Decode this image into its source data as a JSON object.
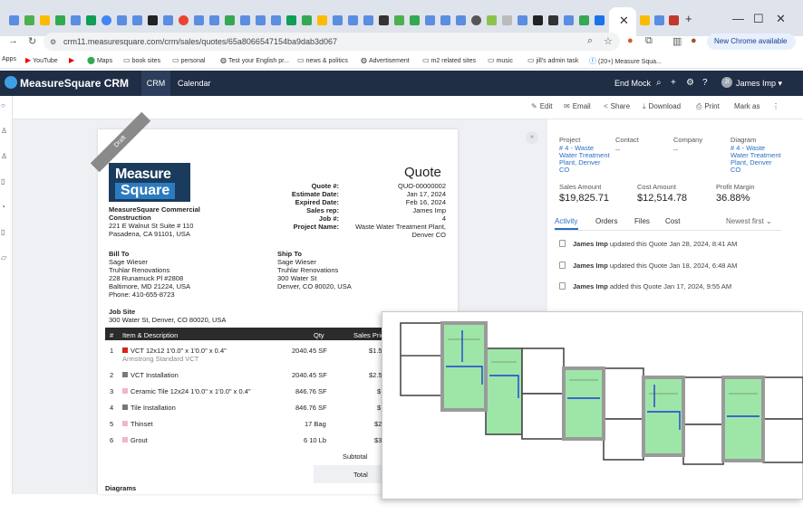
{
  "browser": {
    "url": "crm11.measuresquare.com/crm/sales/quotes/65a8066547154ba9dab3d067",
    "update_label": "New Chrome available",
    "close_tab": "✕"
  },
  "bookmarks": [
    "Apps",
    "YouTube",
    "Maps",
    "book sites",
    "personal",
    "Test your English pr...",
    "news & politics",
    "Advertisement",
    "m2 related sites",
    "music",
    "jill's admin task",
    "(20+) Measure Squa..."
  ],
  "app": {
    "brand": "MeasureSquare CRM",
    "nav": [
      "CRM",
      "Calendar"
    ],
    "end_mock": "End Mock",
    "user_initials": "JI",
    "user_name": "James Imp"
  },
  "toolbar": [
    "Edit",
    "Email",
    "Share",
    "Download",
    "Print",
    "Mark as"
  ],
  "quote_doc": {
    "status": "Draft",
    "logo_line1": "Measure",
    "logo_line2": "Square",
    "company": [
      "MeasureSquare Commercial",
      "Construction",
      "221 E Walnut St Suite # 110",
      "Pasadena, CA 91101, USA"
    ],
    "title": "Quote",
    "fields": [
      {
        "label": "Quote #:",
        "value": "QUO-00000002"
      },
      {
        "label": "Estimate Date:",
        "value": "Jan 17, 2024"
      },
      {
        "label": "Expired Date:",
        "value": "Feb 16, 2024"
      },
      {
        "label": "Sales rep:",
        "value": "James Imp"
      },
      {
        "label": "Job #:",
        "value": "4"
      },
      {
        "label": "Project Name:",
        "value": "Waste Water Treatment Plant,"
      }
    ],
    "project_name_line2": "Denver CO",
    "bill_to": {
      "label": "Bill To",
      "lines": [
        "Sage Wieser",
        "Truhlar Renovations",
        "228 Runamuck Pl #2808",
        "Baltimore, MD 21224, USA",
        "Phone: 410-655-8723"
      ]
    },
    "ship_to": {
      "label": "Ship To",
      "lines": [
        "Sage Wieser",
        "Truhlar Renovations",
        "300 Water St",
        "Denver, CO 80020, USA"
      ]
    },
    "job_site": {
      "label": "Job Site",
      "address": "300 Water St, Denver, CO 80020, USA"
    },
    "columns": [
      "#",
      "Item & Description",
      "Qty",
      "Sales Price"
    ],
    "items": [
      {
        "n": "1",
        "desc": "VCT 12x12 1'0.0\" x 1'0.0\" x 0.4\"",
        "sub": "Armstrong Standard VCT",
        "qty": "2040.45 SF",
        "price": "$1.5",
        "color": "#d9241e"
      },
      {
        "n": "2",
        "desc": "VCT Installation",
        "sub": "",
        "qty": "2040.45 SF",
        "price": "$2.5",
        "color": "#7b7b7b"
      },
      {
        "n": "3",
        "desc": "Ceramic Tile 12x24 1'0.0\" x 1'0.0\" x 0.4\"",
        "sub": "",
        "qty": "846.76 SF",
        "price": "$",
        "color": "#f1b6c8"
      },
      {
        "n": "4",
        "desc": "Tile Installation",
        "sub": "",
        "qty": "846.76 SF",
        "price": "$",
        "color": "#777777"
      },
      {
        "n": "5",
        "desc": "Thinset",
        "sub": "",
        "qty": "17 Bag",
        "price": "$2",
        "color": "#f1b6c8"
      },
      {
        "n": "6",
        "desc": "Grout",
        "sub": "",
        "qty": "6 10 Lb",
        "price": "$3",
        "color": "#f1b6c8"
      }
    ],
    "subtotal_label": "Subtotal",
    "total_label": "Total",
    "diagrams_label": "Diagrams"
  },
  "right_panel": {
    "project": {
      "label": "Project",
      "value": "# 4 - Waste Water Treatment Plant, Denver CO"
    },
    "contact": {
      "label": "Contact",
      "value": "--"
    },
    "company": {
      "label": "Company",
      "value": "--"
    },
    "diagram": {
      "label": "Diagram",
      "value": "# 4 - Waste Water Treatment Plant, Denver CO"
    },
    "metrics": [
      {
        "label": "Sales Amount",
        "value": "$19,825.71"
      },
      {
        "label": "Cost Amount",
        "value": "$12,514.78"
      },
      {
        "label": "Profit Margin",
        "value": "36.88%"
      }
    ],
    "tabs": [
      "Activity",
      "Orders",
      "Files",
      "Cost"
    ],
    "sort": "Newest first",
    "activities": [
      {
        "who": "James Imp",
        "what": "updated this Quote Jan 28, 2024, 8:41 AM"
      },
      {
        "who": "James Imp",
        "what": "updated this Quote Jan 18, 2024, 6:48 AM"
      },
      {
        "who": "James Imp",
        "what": "added this Quote Jan 17, 2024, 9:55 AM"
      }
    ]
  },
  "colors": {
    "header": "#1f2d45",
    "link": "#2a6fc4",
    "floor_green": "#9ee6a8",
    "wall": "#4a4a4a",
    "blue_line": "#1f3fd6"
  }
}
